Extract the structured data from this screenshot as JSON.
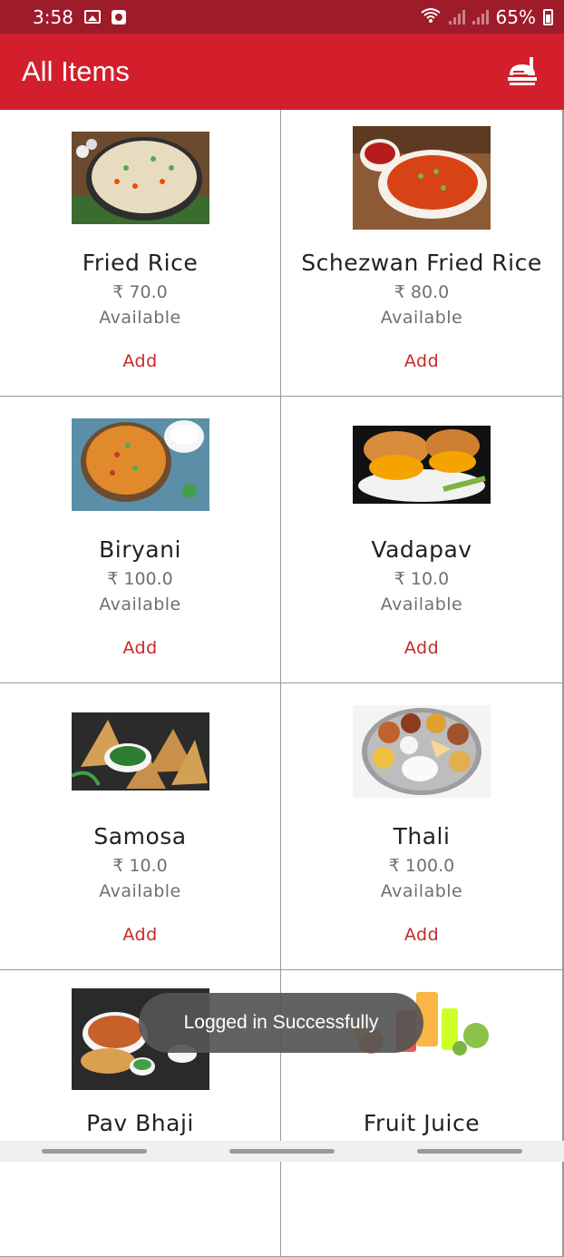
{
  "status_bar": {
    "time": "3:58",
    "battery": "65%"
  },
  "app_bar": {
    "title": "All Items",
    "cart_icon": "food-tray-icon"
  },
  "items": [
    {
      "name": "Fried Rice",
      "price": "₹ 70.0",
      "status": "Available",
      "action": "Add"
    },
    {
      "name": "Schezwan Fried Rice",
      "price": "₹ 80.0",
      "status": "Available",
      "action": "Add"
    },
    {
      "name": "Biryani",
      "price": "₹ 100.0",
      "status": "Available",
      "action": "Add"
    },
    {
      "name": "Vadapav",
      "price": "₹ 10.0",
      "status": "Available",
      "action": "Add"
    },
    {
      "name": "Samosa",
      "price": "₹ 10.0",
      "status": "Available",
      "action": "Add"
    },
    {
      "name": "Thali",
      "price": "₹ 100.0",
      "status": "Available",
      "action": "Add"
    },
    {
      "name": "Pav Bhaji",
      "price": "",
      "status": "",
      "action": ""
    },
    {
      "name": "Fruit Juice",
      "price": "",
      "status": "",
      "action": ""
    }
  ],
  "toast": {
    "message": "Logged in Successfully"
  },
  "colors": {
    "status_bar": "#9e1b2a",
    "app_bar": "#d21f2b",
    "add_text": "#c62828"
  }
}
